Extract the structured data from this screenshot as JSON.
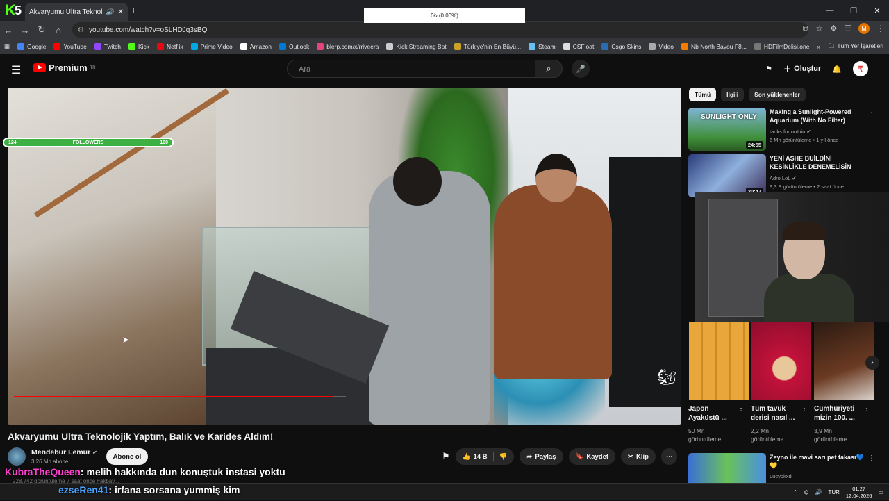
{
  "browser": {
    "tab_title": "Akvaryumu Ultra Teknolojik",
    "donation_text": "0₺ (0.00%)",
    "url": "youtube.com/watch?v=oSLHDJq3sBQ",
    "bookmarks": [
      {
        "label": "Google",
        "color": "#4285f4"
      },
      {
        "label": "YouTube",
        "color": "#ff0000"
      },
      {
        "label": "Twitch",
        "color": "#9146ff"
      },
      {
        "label": "Kick",
        "color": "#53fc18"
      },
      {
        "label": "Netflix",
        "color": "#e50914"
      },
      {
        "label": "Prime Video",
        "color": "#00a8e1"
      },
      {
        "label": "Amazon",
        "color": "#ffffff"
      },
      {
        "label": "Outlook",
        "color": "#0078d4"
      },
      {
        "label": "blerp.com/x/rriveera",
        "color": "#e8447a"
      },
      {
        "label": "Kick Streaming Bot",
        "color": "#cccccc"
      },
      {
        "label": "Türkiye'nin En Büyü...",
        "color": "#c9a227"
      },
      {
        "label": "Steam",
        "color": "#66c0f4"
      },
      {
        "label": "CSFloat",
        "color": "#dddddd"
      },
      {
        "label": "Csgo Skins",
        "color": "#2b6cb0"
      },
      {
        "label": "Video",
        "color": "#aaaaaa"
      },
      {
        "label": "Nb North Bayou F8...",
        "color": "#f57c00"
      },
      {
        "label": "HDFilmDelisi.one",
        "color": "#777777"
      }
    ],
    "all_bookmarks": "Tüm Yer İşaretleri",
    "profile_initial": "M"
  },
  "youtube": {
    "logo": "Premium",
    "logo_region": "TR",
    "search_placeholder": "Ara",
    "create_label": "Oluştur",
    "video_title": "Akvaryumu Ultra Teknolojik Yaptım, Balık ve Karides Aldım!",
    "channel_name": "Mendebur Lemur",
    "channel_subs": "3,26 Mn abone",
    "subscribe_label": "Abone ol",
    "like_count": "14 B",
    "share_label": "Paylaş",
    "save_label": "Kaydet",
    "clip_label": "Klip",
    "views_meta": "228.742 görüntüleme  7 saat önce  #akbay...",
    "progress_fraction": 0.96
  },
  "overlay": {
    "followers_left": "124",
    "followers_label": "FOLLOWERS",
    "followers_right": "100",
    "chat_user": "KubraTheQueen",
    "chat_msg": ": melih hakkında dun konuştuk instasi yoktu",
    "chat_user2": "ezseRen41",
    "chat_msg2": ": irfana sorsana yummiş kim"
  },
  "chips": [
    "Tümü",
    "İlgili",
    "Son yüklenenler"
  ],
  "recommendations": [
    {
      "title": "Making a Sunlight-Powered Aquarium (With No Filter)",
      "channel": "tanks for nothin",
      "meta": "6 Mn görüntüleme • 1 yıl önce",
      "duration": "24:55",
      "thumb_text": "SUNLIGHT ONLY"
    },
    {
      "title": "YENİ ASHE BUİLDİNİ KESİNLİKLE DENEMELİSİN",
      "channel": "Adro LoL",
      "meta": "9,3 B görüntüleme • 2 saat önce",
      "duration": "20:47"
    }
  ],
  "shorts": [
    {
      "title": "Japon Ayaküstü ...",
      "views": "50 Mn görüntüleme"
    },
    {
      "title": "Tüm tavuk derisi nasıl ...",
      "views": "2,2 Mn görüntüleme"
    },
    {
      "title": "Cumhuriyeti mizin 100. ...",
      "views": "3,9 Mn görüntüleme"
    }
  ],
  "rec_last": {
    "title": "Zeyno ile mavi sarı pet takası💙💛",
    "channel": "Lucypkxd"
  },
  "taskbar": {
    "lang": "TUR",
    "time": "01:27",
    "date": "12.04.2026"
  }
}
